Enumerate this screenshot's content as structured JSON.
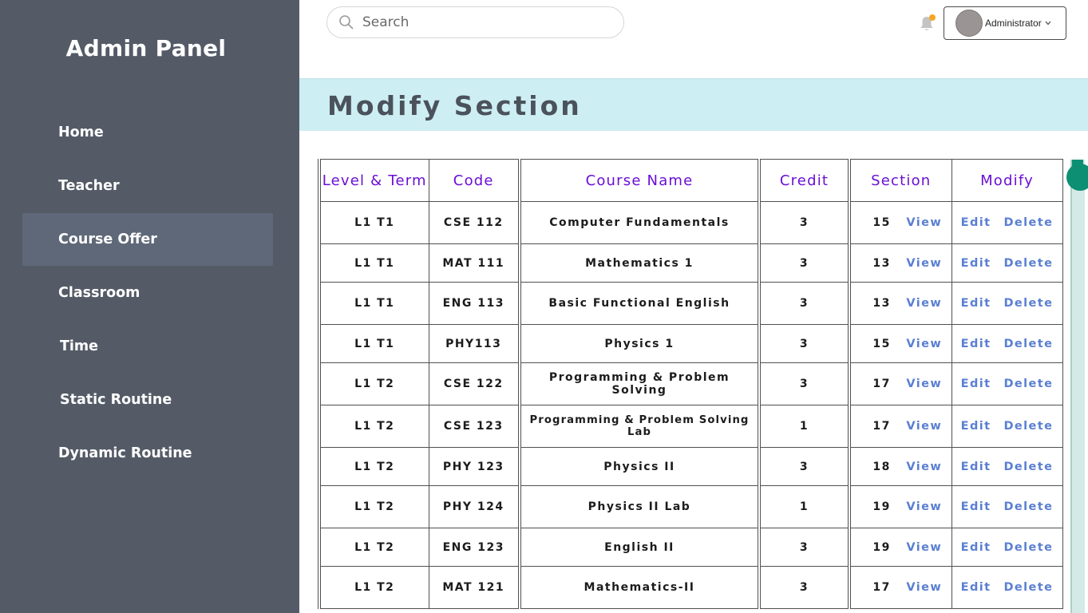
{
  "sidebar": {
    "brand": "Admin Panel",
    "items": [
      {
        "label": "Home",
        "active": false
      },
      {
        "label": "Teacher",
        "active": false
      },
      {
        "label": "Course Offer",
        "active": true
      },
      {
        "label": "Classroom",
        "active": false
      },
      {
        "label": "Time",
        "active": false
      },
      {
        "label": "Static Routine",
        "active": false
      },
      {
        "label": "Dynamic Routine",
        "active": false
      }
    ]
  },
  "topbar": {
    "search_placeholder": "Search",
    "user_label": "Administrator",
    "notification_dot_color": "#f5a623"
  },
  "page": {
    "title": "Modify Section"
  },
  "table": {
    "headers": [
      "Level & Term",
      "Code",
      "Course Name",
      "Credit",
      "Section",
      "Modify"
    ],
    "view_label": "View",
    "edit_label": "Edit",
    "delete_label": "Delete",
    "rows": [
      {
        "level_term": "L1 T1",
        "code": "CSE 112",
        "course_name": "Computer Fundamentals",
        "credit": "3",
        "section": "15"
      },
      {
        "level_term": "L1 T1",
        "code": "MAT 111",
        "course_name": "Mathematics 1",
        "credit": "3",
        "section": "13"
      },
      {
        "level_term": "L1 T1",
        "code": "ENG 113",
        "course_name": "Basic Functional English",
        "credit": "3",
        "section": "13"
      },
      {
        "level_term": "L1 T1",
        "code": "PHY113",
        "course_name": "Physics 1",
        "credit": "3",
        "section": "15"
      },
      {
        "level_term": "L1 T2",
        "code": "CSE 122",
        "course_name": "Programming & Problem Solving",
        "credit": "3",
        "section": "17"
      },
      {
        "level_term": "L1 T2",
        "code": "CSE 123",
        "course_name": "Programming & Problem Solving Lab",
        "credit": "1",
        "section": "17"
      },
      {
        "level_term": "L1 T2",
        "code": "PHY 123",
        "course_name": "Physics II",
        "credit": "3",
        "section": "18"
      },
      {
        "level_term": "L1 T2",
        "code": "PHY 124",
        "course_name": "Physics II Lab",
        "credit": "1",
        "section": "19"
      },
      {
        "level_term": "L1 T2",
        "code": "ENG 123",
        "course_name": "English II",
        "credit": "3",
        "section": "19"
      },
      {
        "level_term": "L1 T2",
        "code": "MAT 121",
        "course_name": "Mathematics-II",
        "credit": "3",
        "section": "17"
      }
    ]
  },
  "colors": {
    "sidebar_bg": "#545b67",
    "active_item_bg": "#5e6878",
    "header_band_bg": "#cdeef3",
    "table_header_text": "#6a0fd4",
    "link": "#5a7fd1",
    "scroll_thumb": "#0c8f72"
  }
}
